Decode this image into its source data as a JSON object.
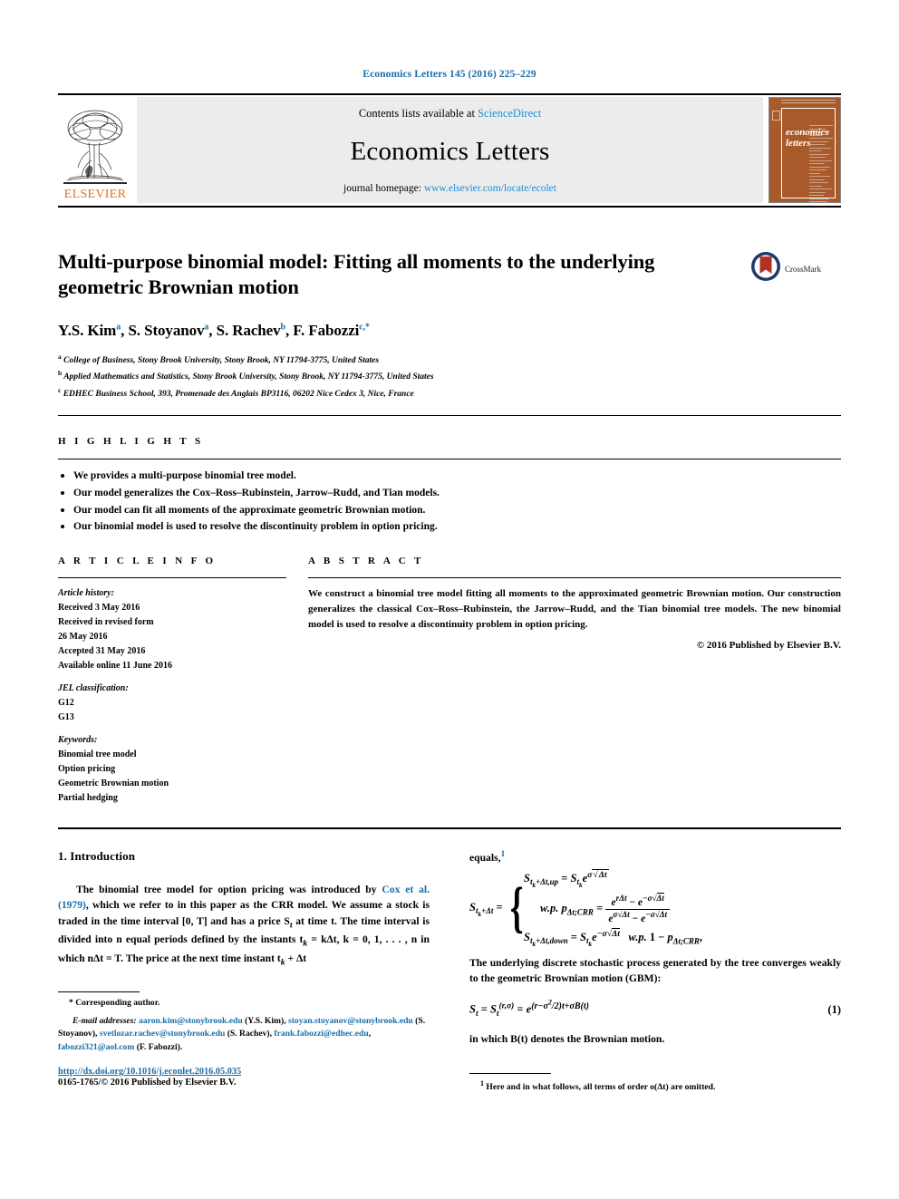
{
  "journal_ref": "Economics Letters 145 (2016) 225–229",
  "masthead": {
    "contents_prefix": "Contents lists available at ",
    "sciencedirect": "ScienceDirect",
    "journal_name": "Economics Letters",
    "homepage_prefix": "journal homepage: ",
    "homepage_url": "www.elsevier.com/locate/ecolet",
    "publisher_word": "ELSEVIER",
    "cover_title_line1": "economics",
    "cover_title_line2": "letters",
    "accent_blue": "#1a8fd0",
    "elsevier_orange": "#e8701a",
    "cover_brown": "#a85a2a"
  },
  "article": {
    "title": "Multi-purpose binomial model: Fitting all moments to the underlying geometric Brownian motion",
    "crossmark_label": "CrossMark",
    "authors": [
      {
        "name": "Y.S. Kim",
        "sup": "a"
      },
      {
        "name": "S. Stoyanov",
        "sup": "a"
      },
      {
        "name": "S. Rachev",
        "sup": "b"
      },
      {
        "name": "F. Fabozzi",
        "sup": "c,*"
      }
    ],
    "affiliations": [
      {
        "marker": "a",
        "text": "College of Business, Stony Brook University, Stony Brook, NY 11794-3775, United States"
      },
      {
        "marker": "b",
        "text": "Applied Mathematics and Statistics, Stony Brook University, Stony Brook, NY 11794-3775, United States"
      },
      {
        "marker": "c",
        "text": "EDHEC Business School, 393, Promenade des Anglais BP3116, 06202 Nice Cedex 3, Nice, France"
      }
    ]
  },
  "highlights": {
    "heading": "H I G H L I G H T S",
    "items": [
      "We provides a multi-purpose binomial tree model.",
      "Our model generalizes the Cox–Ross–Rubinstein, Jarrow–Rudd, and Tian models.",
      "Our model can fit all moments of the approximate geometric Brownian motion.",
      "Our binomial model is used to resolve the discontinuity problem in option pricing."
    ]
  },
  "article_info": {
    "heading": "A R T I C L E    I N F O",
    "history_label": "Article history:",
    "history": [
      "Received 3 May 2016",
      "Received in revised form",
      "26 May 2016",
      "Accepted 31 May 2016",
      "Available online 11 June 2016"
    ],
    "jel_label": "JEL classification:",
    "jel_codes": [
      "G12",
      "G13"
    ],
    "keywords_label": "Keywords:",
    "keywords": [
      "Binomial tree model",
      "Option pricing",
      "Geometric Brownian motion",
      "Partial hedging"
    ]
  },
  "abstract": {
    "heading": "A B S T R A C T",
    "text": "We construct a binomial tree model fitting all moments to the approximated geometric Brownian motion. Our construction generalizes the classical Cox–Ross–Rubinstein, the Jarrow–Rudd, and the Tian binomial tree models. The new binomial model is used to resolve a discontinuity problem in option pricing.",
    "copyright": "© 2016 Published by Elsevier B.V."
  },
  "body": {
    "section_title": "1. Introduction",
    "para1_pre": "The binomial tree model for option pricing was introduced by ",
    "para1_cite": "Cox et al. (1979)",
    "para1_post": ", which we refer to in this paper as the CRR model. We assume a stock is traded in the time interval [0, T] and has a price S",
    "para1_post_b": " at time t. The time interval is divided into n equal periods defined by the instants t",
    "para1_post_c": " = kΔt, k = 0, 1, . . . , n in which nΔt = T. The price at the next time instant t",
    "para1_post_d": " + Δt",
    "equals_label": "equals,",
    "equals_footnote_marker": "1",
    "eq_up_lhs": "S",
    "eq_text_gbm": "The underlying discrete stochastic process generated by the tree converges weakly to the geometric Brownian motion (GBM):",
    "eq_number": "(1)",
    "eq_tail_text": "in which B(t) denotes the Brownian motion.",
    "math": {
      "piecewise_lhs": "S_{t_k+Δt} =",
      "row_up": "S_{t_k+Δt,up} = S_{t_k} e^{σ√Δt}",
      "row_prob_label": "w.p. p_{Δt;CRR} =",
      "row_prob_num": "e^{rΔt} − e^{−σ√Δt}",
      "row_prob_den": "e^{σ√Δt} − e^{−σ√Δt}",
      "row_down": "S_{t_k+Δt,down} = S_{t_k} e^{−σ√Δt}   w.p. 1 − p_{Δt;CRR},",
      "eq1": "S_t = S_t^{(r,σ)} = e^{(r−σ²/2)t+σB(t)}"
    }
  },
  "footnotes": {
    "corresponding_marker": "*",
    "corresponding_text": "Corresponding author.",
    "email_label": "E-mail addresses:",
    "emails": [
      {
        "address": "aaron.kim@stonybrook.edu",
        "owner": "(Y.S. Kim)"
      },
      {
        "address": "stoyan.stoyanov@stonybrook.edu",
        "owner": "(S. Stoyanov)"
      },
      {
        "address": "svetlozar.rachev@stonybrook.edu",
        "owner": "(S. Rachev)"
      },
      {
        "address": "frank.fabozzi@edhec.edu",
        "owner": ""
      },
      {
        "address": "fabozzi321@aol.com",
        "owner": "(F. Fabozzi)"
      }
    ],
    "doi": "http://dx.doi.org/10.1016/j.econlet.2016.05.035",
    "issn": "0165-1765/© 2016 Published by Elsevier B.V.",
    "right_marker": "1",
    "right_text": "Here and in what follows, all terms of order o(Δt) are omitted."
  }
}
